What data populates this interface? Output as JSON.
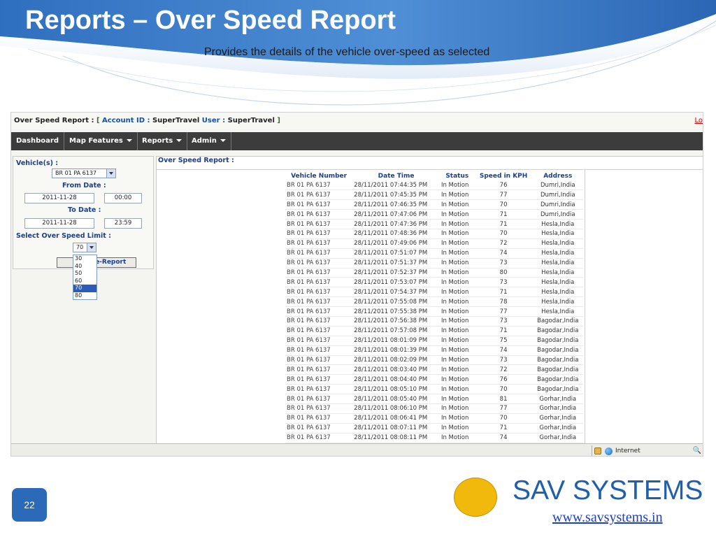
{
  "slide": {
    "title": "Reports – Over Speed Report",
    "subtitle": "Provides the details of the vehicle over-speed as selected",
    "page_number": "22",
    "brand": "SAV SYSTEMS",
    "website": "www.savsystems.in",
    "colors": {
      "header_blue": "#1f5fab",
      "logo_yellow": "#f2b90d",
      "menu_dark": "#3c3c3c"
    }
  },
  "app": {
    "title_prefix": "Over Speed Report :",
    "bracket_open": "[",
    "account_label": "Account ID :",
    "account_value": "SuperTravel",
    "user_label": "User :",
    "user_value": "SuperTravel",
    "bracket_close": "]",
    "logout_partial": "Lo",
    "menu": [
      {
        "label": "Dashboard",
        "dropdown": false
      },
      {
        "label": "Map Features",
        "dropdown": true
      },
      {
        "label": "Reports",
        "dropdown": true
      },
      {
        "label": "Admin",
        "dropdown": true
      }
    ],
    "filter": {
      "vehicles_label": "Vehicle(s) :",
      "vehicle_selected": "BR 01 PA 6137",
      "from_date_label": "From Date :",
      "from_date": "2011-11-28",
      "from_time": "00:00",
      "to_date_label": "To Date :",
      "to_date": "2011-11-28",
      "to_time": "23:59",
      "speed_limit_label": "Select Over Speed Limit :",
      "speed_limit_selected": "70",
      "speed_options": [
        "30",
        "40",
        "50",
        "60",
        "70",
        "80"
      ],
      "speed_options_highlighted": "70",
      "generate_button_visible": "ate-Report"
    },
    "report": {
      "title": "Over Speed Report :",
      "columns": [
        "Vehicle Number",
        "Date Time",
        "Status",
        "Speed in KPH",
        "Address"
      ],
      "rows": [
        [
          "BR 01 PA 6137",
          "28/11/2011 07:44:35 PM",
          "In Motion",
          "76",
          "Dumri,India"
        ],
        [
          "BR 01 PA 6137",
          "28/11/2011 07:45:35 PM",
          "In Motion",
          "77",
          "Dumri,India"
        ],
        [
          "BR 01 PA 6137",
          "28/11/2011 07:46:35 PM",
          "In Motion",
          "70",
          "Dumri,India"
        ],
        [
          "BR 01 PA 6137",
          "28/11/2011 07:47:06 PM",
          "In Motion",
          "71",
          "Dumri,India"
        ],
        [
          "BR 01 PA 6137",
          "28/11/2011 07:47:36 PM",
          "In Motion",
          "71",
          "Hesla,India"
        ],
        [
          "BR 01 PA 6137",
          "28/11/2011 07:48:36 PM",
          "In Motion",
          "70",
          "Hesla,India"
        ],
        [
          "BR 01 PA 6137",
          "28/11/2011 07:49:06 PM",
          "In Motion",
          "72",
          "Hesla,India"
        ],
        [
          "BR 01 PA 6137",
          "28/11/2011 07:51:07 PM",
          "In Motion",
          "74",
          "Hesla,India"
        ],
        [
          "BR 01 PA 6137",
          "28/11/2011 07:51:37 PM",
          "In Motion",
          "73",
          "Hesla,India"
        ],
        [
          "BR 01 PA 6137",
          "28/11/2011 07:52:37 PM",
          "In Motion",
          "80",
          "Hesla,India"
        ],
        [
          "BR 01 PA 6137",
          "28/11/2011 07:53:07 PM",
          "In Motion",
          "73",
          "Hesla,India"
        ],
        [
          "BR 01 PA 6137",
          "28/11/2011 07:54:37 PM",
          "In Motion",
          "71",
          "Hesla,India"
        ],
        [
          "BR 01 PA 6137",
          "28/11/2011 07:55:08 PM",
          "In Motion",
          "78",
          "Hesla,India"
        ],
        [
          "BR 01 PA 6137",
          "28/11/2011 07:55:38 PM",
          "In Motion",
          "77",
          "Hesla,India"
        ],
        [
          "BR 01 PA 6137",
          "28/11/2011 07:56:38 PM",
          "In Motion",
          "73",
          "Bagodar,India"
        ],
        [
          "BR 01 PA 6137",
          "28/11/2011 07:57:08 PM",
          "In Motion",
          "71",
          "Bagodar,India"
        ],
        [
          "BR 01 PA 6137",
          "28/11/2011 08:01:09 PM",
          "In Motion",
          "75",
          "Bagodar,India"
        ],
        [
          "BR 01 PA 6137",
          "28/11/2011 08:01:39 PM",
          "In Motion",
          "74",
          "Bagodar,India"
        ],
        [
          "BR 01 PA 6137",
          "28/11/2011 08:02:09 PM",
          "In Motion",
          "73",
          "Bagodar,India"
        ],
        [
          "BR 01 PA 6137",
          "28/11/2011 08:03:40 PM",
          "In Motion",
          "72",
          "Bagodar,India"
        ],
        [
          "BR 01 PA 6137",
          "28/11/2011 08:04:40 PM",
          "In Motion",
          "76",
          "Bagodar,India"
        ],
        [
          "BR 01 PA 6137",
          "28/11/2011 08:05:10 PM",
          "In Motion",
          "70",
          "Bagodar,India"
        ],
        [
          "BR 01 PA 6137",
          "28/11/2011 08:05:40 PM",
          "In Motion",
          "81",
          "Gorhar,India"
        ],
        [
          "BR 01 PA 6137",
          "28/11/2011 08:06:10 PM",
          "In Motion",
          "77",
          "Gorhar,India"
        ],
        [
          "BR 01 PA 6137",
          "28/11/2011 08:06:41 PM",
          "In Motion",
          "70",
          "Gorhar,India"
        ],
        [
          "BR 01 PA 6137",
          "28/11/2011 08:07:11 PM",
          "In Motion",
          "71",
          "Gorhar,India"
        ],
        [
          "BR 01 PA 6137",
          "28/11/2011 08:08:11 PM",
          "In Motion",
          "74",
          "Gorhar,India"
        ]
      ]
    },
    "statusbar": {
      "zone": "Internet",
      "icons": [
        "lock-icon",
        "globe-icon",
        "zoom-icon"
      ]
    }
  }
}
